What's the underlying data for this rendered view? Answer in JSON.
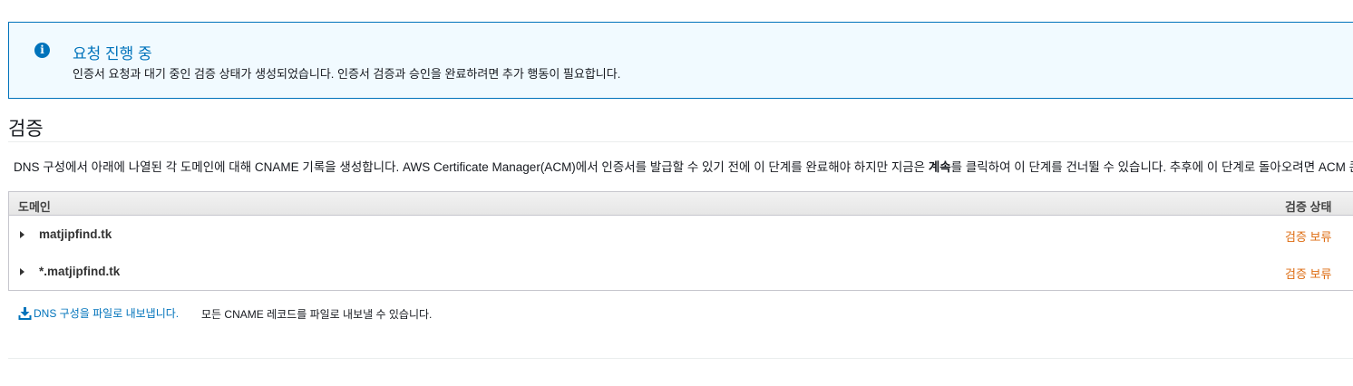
{
  "alert": {
    "icon": "info-icon",
    "title": "요청 진행 중",
    "message": "인증서 요청과 대기 중인 검증 상태가 생성되었습니다. 인증서 검증과 승인을 완료하려면 추가 행동이 필요합니다.",
    "accent_color": "#0073bb"
  },
  "section": {
    "title": "검증",
    "description_before": "DNS 구성에서 아래에 나열된 각 도메인에 대해 CNAME 기록을 생성합니다. AWS Certificate Manager(ACM)에서 인증서를 발급할 수 있기 전에 이 단계를 완료해야 하지만 지금은 ",
    "description_bold": "계속",
    "description_after": "를 클릭하여 이 단계를 건너뛸 수 있습니다. 추후에 이 단계로 돌아오려면 ACM 콘솔"
  },
  "table": {
    "headers": {
      "domain": "도메인",
      "status": "검증 상태"
    },
    "rows": [
      {
        "domain": "matjipfind.tk",
        "status": "검증 보류"
      },
      {
        "domain": "*.matjipfind.tk",
        "status": "검증 보류"
      }
    ],
    "status_color": "#dd6b10"
  },
  "export": {
    "icon": "download-icon",
    "link_label": "DNS 구성을 파일로 내보냅니다.",
    "note": "모든 CNAME 레코드를 파일로 내보낼 수 있습니다."
  }
}
